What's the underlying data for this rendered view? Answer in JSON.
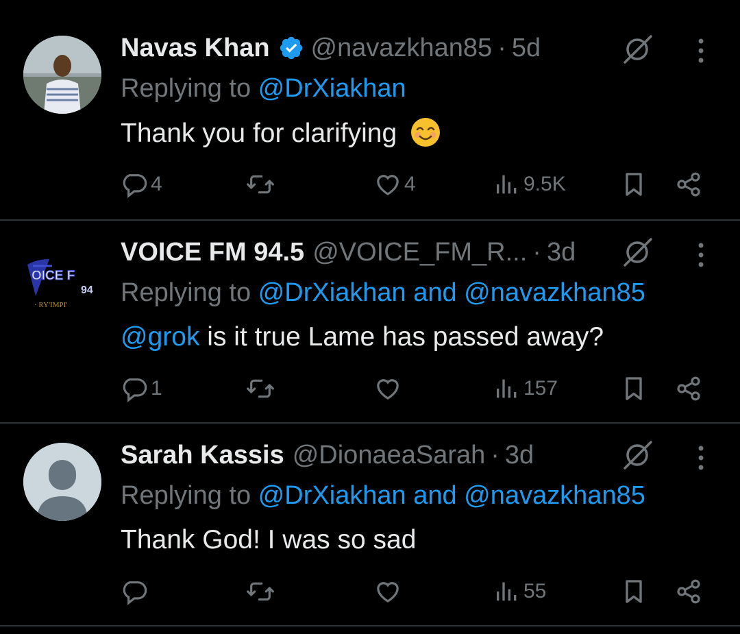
{
  "colors": {
    "background": "#000000",
    "text_primary": "#e7e9ea",
    "text_secondary": "#71767b",
    "link": "#1d9bf0",
    "divider": "#2f3336",
    "verified": "#1d9bf0"
  },
  "tweets": [
    {
      "name": "Navas Khan",
      "verified": true,
      "handle": "@navazkhan85",
      "dot": "·",
      "time": "5d",
      "reply_prefix": "Replying to ",
      "reply_to": "@DrXiakhan",
      "text": "Thank you for clarifying",
      "emoji": "smiling-face-emoji",
      "replies": "4",
      "reposts": "",
      "likes": "4",
      "views": "9.5K"
    },
    {
      "name": "VOICE FM 94.5",
      "verified": false,
      "handle": "@VOICE_FM_R...",
      "dot": "·",
      "time": "3d",
      "reply_prefix": "Replying to ",
      "reply_to": "@DrXiakhan and @navazkhan85",
      "mention": "@grok",
      "text": " is it true Lame has passed away?",
      "replies": "1",
      "reposts": "",
      "likes": "",
      "views": "157",
      "avatar_logo": {
        "line1": "OICE F",
        "line2": "94",
        "line3": "· RY'IMPI'"
      }
    },
    {
      "name": "Sarah Kassis",
      "verified": false,
      "handle": "@DionaeaSarah",
      "dot": "·",
      "time": "3d",
      "reply_prefix": "Replying to ",
      "reply_to": "@DrXiakhan and @navazkhan85",
      "text": "Thank God! I was so sad",
      "replies": "",
      "reposts": "",
      "likes": "",
      "views": "55"
    }
  ]
}
